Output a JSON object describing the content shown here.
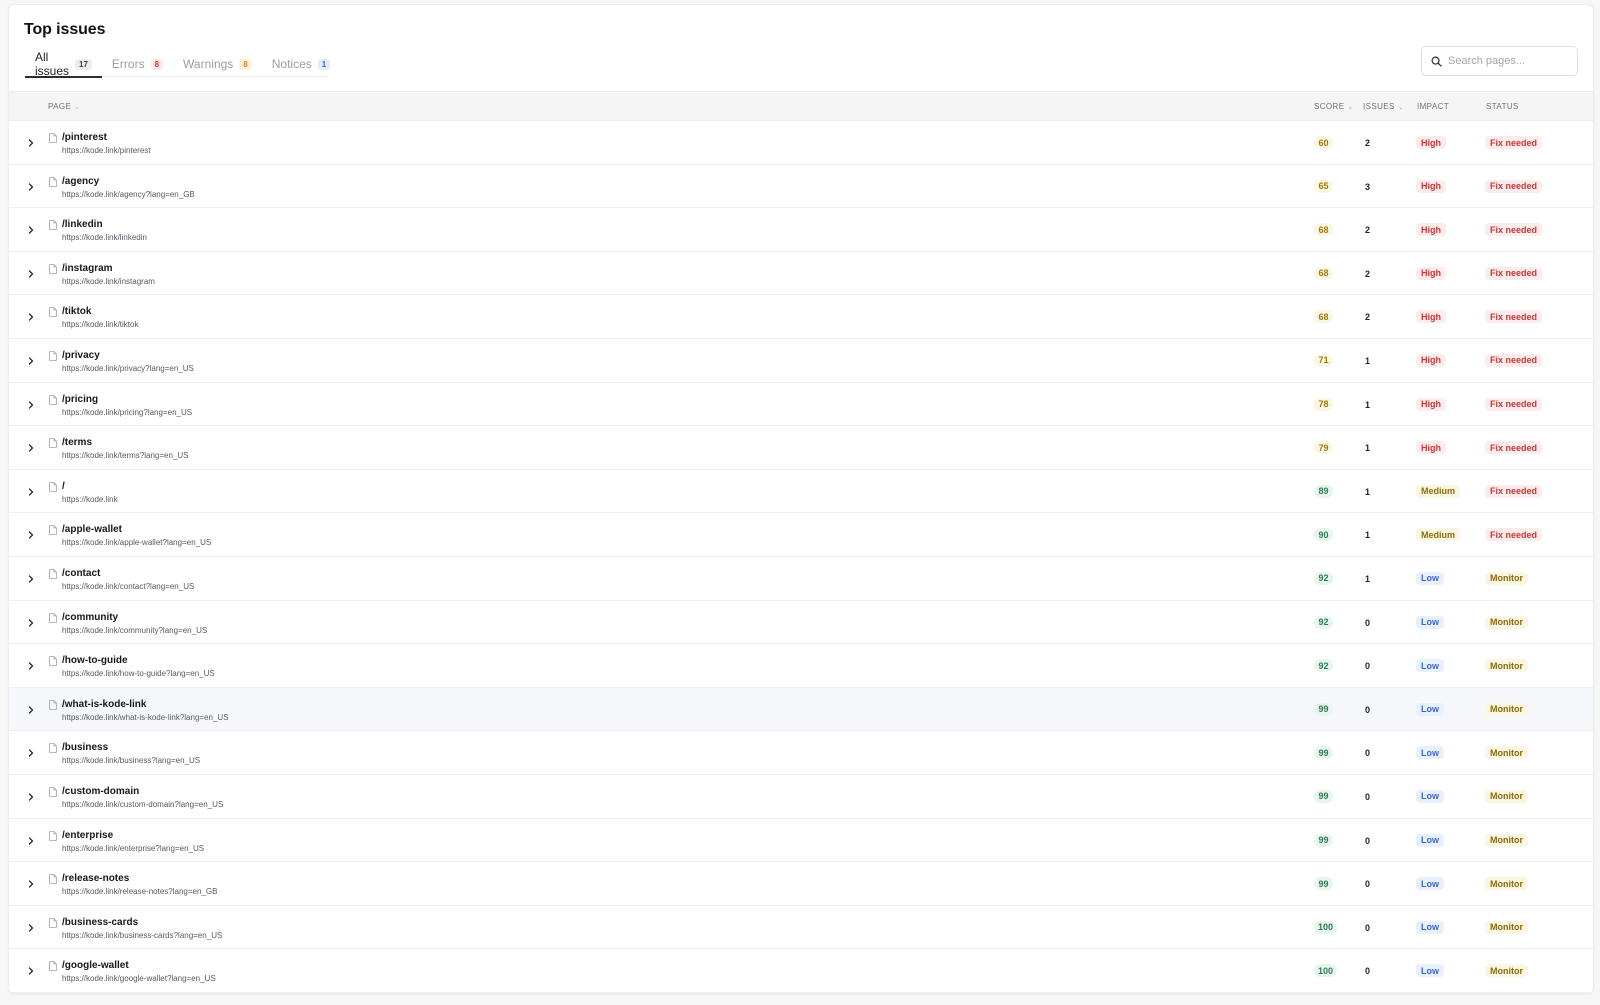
{
  "header": {
    "title": "Top issues",
    "tabs": [
      {
        "label": "All issues",
        "count": "17"
      },
      {
        "label": "Errors",
        "count": "8"
      },
      {
        "label": "Warnings",
        "count": "8"
      },
      {
        "label": "Notices",
        "count": "1"
      }
    ],
    "search": {
      "placeholder": "Search pages..."
    }
  },
  "table": {
    "columns": {
      "page": "PAGE",
      "score": "SCORE",
      "issues": "ISSUES",
      "impact": "IMPACT",
      "status": "STATUS"
    },
    "rows": [
      {
        "page": "/pinterest",
        "url": "https://kode.link/pinterest",
        "score": "60",
        "issues": "2",
        "impact": "High",
        "status": "Fix needed"
      },
      {
        "page": "/agency",
        "url": "https://kode.link/agency?lang=en_GB",
        "score": "65",
        "issues": "3",
        "impact": "High",
        "status": "Fix needed"
      },
      {
        "page": "/linkedin",
        "url": "https://kode.link/linkedin",
        "score": "68",
        "issues": "2",
        "impact": "High",
        "status": "Fix needed"
      },
      {
        "page": "/instagram",
        "url": "https://kode.link/instagram",
        "score": "68",
        "issues": "2",
        "impact": "High",
        "status": "Fix needed"
      },
      {
        "page": "/tiktok",
        "url": "https://kode.link/tiktok",
        "score": "68",
        "issues": "2",
        "impact": "High",
        "status": "Fix needed"
      },
      {
        "page": "/privacy",
        "url": "https://kode.link/privacy?lang=en_US",
        "score": "71",
        "issues": "1",
        "impact": "High",
        "status": "Fix needed"
      },
      {
        "page": "/pricing",
        "url": "https://kode.link/pricing?lang=en_US",
        "score": "78",
        "issues": "1",
        "impact": "High",
        "status": "Fix needed"
      },
      {
        "page": "/terms",
        "url": "https://kode.link/terms?lang=en_US",
        "score": "79",
        "issues": "1",
        "impact": "High",
        "status": "Fix needed"
      },
      {
        "page": "/",
        "url": "https://kode.link",
        "score": "89",
        "issues": "1",
        "impact": "Medium",
        "status": "Fix needed"
      },
      {
        "page": "/apple-wallet",
        "url": "https://kode.link/apple-wallet?lang=en_US",
        "score": "90",
        "issues": "1",
        "impact": "Medium",
        "status": "Fix needed"
      },
      {
        "page": "/contact",
        "url": "https://kode.link/contact?lang=en_US",
        "score": "92",
        "issues": "1",
        "impact": "Low",
        "status": "Monitor"
      },
      {
        "page": "/community",
        "url": "https://kode.link/community?lang=en_US",
        "score": "92",
        "issues": "0",
        "impact": "Low",
        "status": "Monitor"
      },
      {
        "page": "/how-to-guide",
        "url": "https://kode.link/how-to-guide?lang=en_US",
        "score": "92",
        "issues": "0",
        "impact": "Low",
        "status": "Monitor"
      },
      {
        "page": "/what-is-kode-link",
        "url": "https://kode.link/what-is-kode-link?lang=en_US",
        "score": "99",
        "issues": "0",
        "impact": "Low",
        "status": "Monitor"
      },
      {
        "page": "/business",
        "url": "https://kode.link/business?lang=en_US",
        "score": "99",
        "issues": "0",
        "impact": "Low",
        "status": "Monitor"
      },
      {
        "page": "/custom-domain",
        "url": "https://kode.link/custom-domain?lang=en_US",
        "score": "99",
        "issues": "0",
        "impact": "Low",
        "status": "Monitor"
      },
      {
        "page": "/enterprise",
        "url": "https://kode.link/enterprise?lang=en_US",
        "score": "99",
        "issues": "0",
        "impact": "Low",
        "status": "Monitor"
      },
      {
        "page": "/release-notes",
        "url": "https://kode.link/release-notes?lang=en_GB",
        "score": "99",
        "issues": "0",
        "impact": "Low",
        "status": "Monitor"
      },
      {
        "page": "/business-cards",
        "url": "https://kode.link/business-cards?lang=en_US",
        "score": "100",
        "issues": "0",
        "impact": "Low",
        "status": "Monitor"
      },
      {
        "page": "/google-wallet",
        "url": "https://kode.link/google-wallet?lang=en_US",
        "score": "100",
        "issues": "0",
        "impact": "Low",
        "status": "Monitor"
      }
    ]
  },
  "colors": {
    "high": "#cc3737",
    "medium": "#8f6d0c",
    "low": "#3d68d1",
    "score_good": "#2e7d52",
    "score_warn": "#a17a0c"
  },
  "icons": {
    "expand": "chevron-right-icon",
    "page": "document-icon",
    "search": "search-icon",
    "sort": "sort-caret-icon"
  }
}
